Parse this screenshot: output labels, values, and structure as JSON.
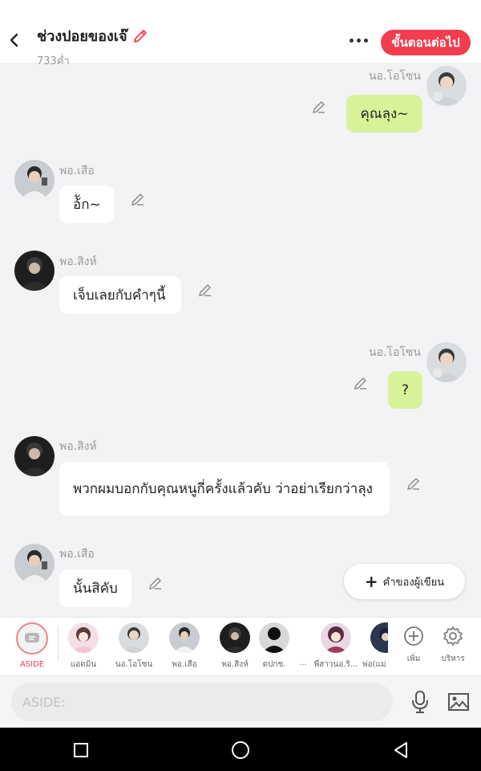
{
  "header": {
    "title": "ช่วงปอยของเจ๊",
    "count": "733ค่ำ",
    "next_label": "ขั้นตอนต่อไป"
  },
  "messages": [
    {
      "side": "right",
      "name": "นอ.โอโซน",
      "text": "คุณลุง~",
      "avatar": "avatar-o-ozone"
    },
    {
      "side": "left",
      "name": "พอ.เสือ",
      "text": "อ้ัก~",
      "avatar": "avatar-po-suea"
    },
    {
      "side": "left",
      "name": "พอ.สิงห์",
      "text": "เจ็บเลยกับคำๆนี้",
      "avatar": "avatar-po-sing"
    },
    {
      "side": "right",
      "name": "นอ.โอโซน",
      "text": "?",
      "avatar": "avatar-o-ozone"
    },
    {
      "side": "left",
      "name": "พอ.สิงห์",
      "text": "พวกผมบอกกับคุณหนูกี่ครั้งแล้วคับ ว่าอย่าเรียกว่าลุง",
      "avatar": "avatar-po-sing"
    },
    {
      "side": "left",
      "name": "พอ.เสือ",
      "text": "นั้นสิคับ",
      "avatar": "avatar-po-suea"
    }
  ],
  "writer_button": "คำของผู้เขียน",
  "characters": [
    {
      "label": "ASIDE"
    },
    {
      "label": "แอดมิน"
    },
    {
      "label": "นอ.โอโซน"
    },
    {
      "label": "พอ.เสือ"
    },
    {
      "label": "พอ.สิงห์"
    },
    {
      "label": "ดปกช."
    },
    {
      "label": "..."
    },
    {
      "label": "พี่สาวนอ.ริ..."
    },
    {
      "label": "พ่อ(แม่"
    }
  ],
  "tools": {
    "add_label": "เพิ่ม",
    "manage_label": "บริหาร"
  },
  "input": {
    "placeholder": "ASIDE:"
  },
  "colors": {
    "accent": "#f23d4f",
    "right_bubble": "#d8f29a",
    "left_bubble": "#ffffff",
    "background": "#f3f3f5"
  },
  "icons": [
    "back-arrow-icon",
    "pencil-icon",
    "more-icon",
    "edit-icon",
    "plus-icon",
    "chat-icon",
    "add-circle-icon",
    "gear-icon",
    "mic-icon",
    "image-icon",
    "square-icon",
    "circle-icon",
    "triangle-back-icon"
  ]
}
